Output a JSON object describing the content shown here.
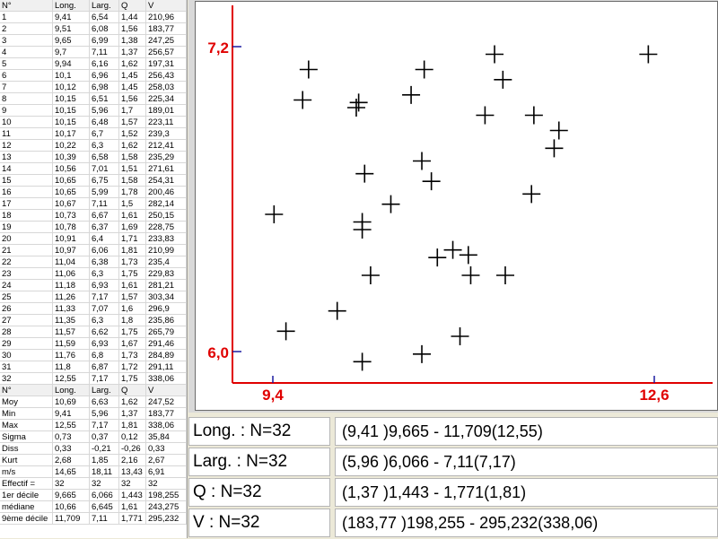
{
  "table": {
    "headers": [
      "N°",
      "Long.",
      "Larg.",
      "Q",
      "V"
    ],
    "rows": [
      [
        "1",
        "9,41",
        "6,54",
        "1,44",
        "210,96"
      ],
      [
        "2",
        "9,51",
        "6,08",
        "1,56",
        "183,77"
      ],
      [
        "3",
        "9,65",
        "6,99",
        "1,38",
        "247,25"
      ],
      [
        "4",
        "9,7",
        "7,11",
        "1,37",
        "256,57"
      ],
      [
        "5",
        "9,94",
        "6,16",
        "1,62",
        "197,31"
      ],
      [
        "6",
        "10,1",
        "6,96",
        "1,45",
        "256,43"
      ],
      [
        "7",
        "10,12",
        "6,98",
        "1,45",
        "258,03"
      ],
      [
        "8",
        "10,15",
        "6,51",
        "1,56",
        "225,34"
      ],
      [
        "9",
        "10,15",
        "5,96",
        "1,7",
        "189,01"
      ],
      [
        "10",
        "10,15",
        "6,48",
        "1,57",
        "223,11"
      ],
      [
        "11",
        "10,17",
        "6,7",
        "1,52",
        "239,3"
      ],
      [
        "12",
        "10,22",
        "6,3",
        "1,62",
        "212,41"
      ],
      [
        "13",
        "10,39",
        "6,58",
        "1,58",
        "235,29"
      ],
      [
        "14",
        "10,56",
        "7,01",
        "1,51",
        "271,61"
      ],
      [
        "15",
        "10,65",
        "6,75",
        "1,58",
        "254,31"
      ],
      [
        "16",
        "10,65",
        "5,99",
        "1,78",
        "200,46"
      ],
      [
        "17",
        "10,67",
        "7,11",
        "1,5",
        "282,14"
      ],
      [
        "18",
        "10,73",
        "6,67",
        "1,61",
        "250,15"
      ],
      [
        "19",
        "10,78",
        "6,37",
        "1,69",
        "228,75"
      ],
      [
        "20",
        "10,91",
        "6,4",
        "1,71",
        "233,83"
      ],
      [
        "21",
        "10,97",
        "6,06",
        "1,81",
        "210,99"
      ],
      [
        "22",
        "11,04",
        "6,38",
        "1,73",
        "235,4"
      ],
      [
        "23",
        "11,06",
        "6,3",
        "1,75",
        "229,83"
      ],
      [
        "24",
        "11,18",
        "6,93",
        "1,61",
        "281,21"
      ],
      [
        "25",
        "11,26",
        "7,17",
        "1,57",
        "303,34"
      ],
      [
        "26",
        "11,33",
        "7,07",
        "1,6",
        "296,9"
      ],
      [
        "27",
        "11,35",
        "6,3",
        "1,8",
        "235,86"
      ],
      [
        "28",
        "11,57",
        "6,62",
        "1,75",
        "265,79"
      ],
      [
        "29",
        "11,59",
        "6,93",
        "1,67",
        "291,46"
      ],
      [
        "30",
        "11,76",
        "6,8",
        "1,73",
        "284,89"
      ],
      [
        "31",
        "11,8",
        "6,87",
        "1,72",
        "291,11"
      ],
      [
        "32",
        "12,55",
        "7,17",
        "1,75",
        "338,06"
      ]
    ],
    "stats_headers": [
      "N°",
      "Long.",
      "Larg.",
      "Q",
      "V"
    ],
    "stats": [
      [
        "Moy",
        "10,69",
        "6,63",
        "1,62",
        "247,52"
      ],
      [
        "Min",
        "9,41",
        "5,96",
        "1,37",
        "183,77"
      ],
      [
        "Max",
        "12,55",
        "7,17",
        "1,81",
        "338,06"
      ],
      [
        "Sigma",
        "0,73",
        "0,37",
        "0,12",
        "35,84"
      ],
      [
        "Diss",
        "0,33",
        "-0,21",
        "-0,26",
        "0,33"
      ],
      [
        "Kurt",
        "2,68",
        "1,85",
        "2,16",
        "2,67"
      ],
      [
        "m/s",
        "14,65",
        "18,11",
        "13,43",
        "6,91"
      ],
      [
        "Effectif =",
        "32",
        "32",
        "32",
        "32"
      ],
      [
        "1er décile",
        "9,665",
        "6,066",
        "1,443",
        "198,255"
      ],
      [
        "médiane",
        "10,66",
        "6,645",
        "1,61",
        "243,275"
      ],
      [
        "9ème décile",
        "11,709",
        "7,11",
        "1,771",
        "295,232"
      ]
    ]
  },
  "chart_data": {
    "type": "scatter",
    "xlim": [
      9.4,
      12.6
    ],
    "ylim": [
      6.0,
      7.2
    ],
    "x_tick_labels": [
      "9,4",
      "12,6"
    ],
    "y_tick_labels": [
      "7,2",
      "6,0"
    ],
    "axis_color": "#e00000",
    "marker": "plus",
    "points": [
      [
        9.41,
        6.54
      ],
      [
        9.51,
        6.08
      ],
      [
        9.65,
        6.99
      ],
      [
        9.7,
        7.11
      ],
      [
        9.94,
        6.16
      ],
      [
        10.1,
        6.96
      ],
      [
        10.12,
        6.98
      ],
      [
        10.15,
        6.51
      ],
      [
        10.15,
        5.96
      ],
      [
        10.15,
        6.48
      ],
      [
        10.17,
        6.7
      ],
      [
        10.22,
        6.3
      ],
      [
        10.39,
        6.58
      ],
      [
        10.56,
        7.01
      ],
      [
        10.65,
        6.75
      ],
      [
        10.65,
        5.99
      ],
      [
        10.67,
        7.11
      ],
      [
        10.73,
        6.67
      ],
      [
        10.78,
        6.37
      ],
      [
        10.91,
        6.4
      ],
      [
        10.97,
        6.06
      ],
      [
        11.04,
        6.38
      ],
      [
        11.06,
        6.3
      ],
      [
        11.18,
        6.93
      ],
      [
        11.26,
        7.17
      ],
      [
        11.33,
        7.07
      ],
      [
        11.35,
        6.3
      ],
      [
        11.57,
        6.62
      ],
      [
        11.59,
        6.93
      ],
      [
        11.76,
        6.8
      ],
      [
        11.8,
        6.87
      ],
      [
        12.55,
        7.17
      ]
    ]
  },
  "summary": [
    {
      "label": "Long. : N=32",
      "value": "(9,41 )9,665 - 11,709(12,55)"
    },
    {
      "label": "Larg. : N=32",
      "value": "(5,96 )6,066 - 7,11(7,17)"
    },
    {
      "label": "Q : N=32",
      "value": "(1,37 )1,443 - 1,771(1,81)"
    },
    {
      "label": "V : N=32",
      "value": "(183,77 )198,255 - 295,232(338,06)"
    }
  ]
}
